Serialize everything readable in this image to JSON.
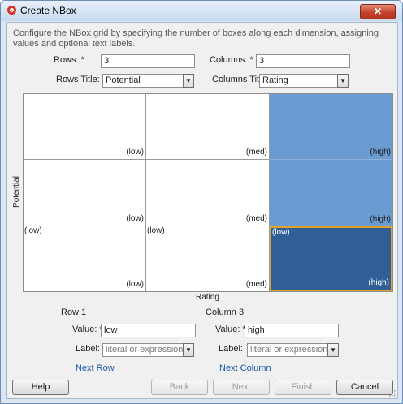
{
  "window": {
    "title": "Create NBox",
    "close_symbol": "✕"
  },
  "description": "Configure the NBox grid by specifying the number of boxes along each dimension, assigning values and optional text labels.",
  "rows": {
    "label": "Rows: *",
    "value": "3"
  },
  "columns": {
    "label": "Columns: *",
    "value": "3"
  },
  "rows_title": {
    "label": "Rows Title:",
    "value": "Potential"
  },
  "columns_title": {
    "label": "Columns Title:",
    "value": "Rating"
  },
  "grid": {
    "row_axis_title": "Potential",
    "column_axis_title": "Rating",
    "cells": [
      [
        "(low)",
        "(med)",
        "(high)"
      ],
      [
        "(low)",
        "(med)",
        "(high)"
      ],
      [
        "(low)",
        "(low)",
        "(low)"
      ],
      [
        "(low)",
        "(med)",
        "(high)"
      ]
    ],
    "colors": {
      "default": "#ffffff",
      "column_highlight": "#6a9bd1",
      "selected": "#2f5f96",
      "selected_border": "#e0a22c"
    }
  },
  "row_section": {
    "title": "Row 1",
    "value_label": "Value: *",
    "value": "low",
    "label_label": "Label:",
    "label_placeholder": "literal or expression",
    "next": "Next Row"
  },
  "column_section": {
    "title": "Column 3",
    "value_label": "Value: *",
    "value": "high",
    "label_label": "Label:",
    "label_placeholder": "literal or expression",
    "next": "Next Column"
  },
  "buttons": {
    "help": "Help",
    "back": "Back",
    "next": "Next",
    "finish": "Finish",
    "cancel": "Cancel"
  },
  "icons": {
    "dropdown": "chevron-down-icon",
    "app": "app-icon",
    "close": "close-icon"
  }
}
